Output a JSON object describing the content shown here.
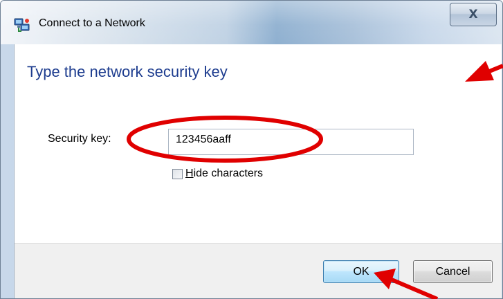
{
  "window": {
    "title": "Connect to a Network",
    "close_symbol": "X"
  },
  "content": {
    "heading": "Type the network security key",
    "security_key_label": "Security key:",
    "security_key_value": "123456aaff",
    "hide_characters": {
      "underlined_letter": "H",
      "rest": "ide characters",
      "checked": false
    }
  },
  "footer": {
    "ok_label": "OK",
    "cancel_label": "Cancel"
  },
  "icons": {
    "title_icon": "network-connection-icon",
    "close_icon": "close-icon"
  },
  "colors": {
    "heading": "#1e3d8f",
    "annotation_red": "#e00000",
    "ok_border": "#3c7fb1"
  }
}
